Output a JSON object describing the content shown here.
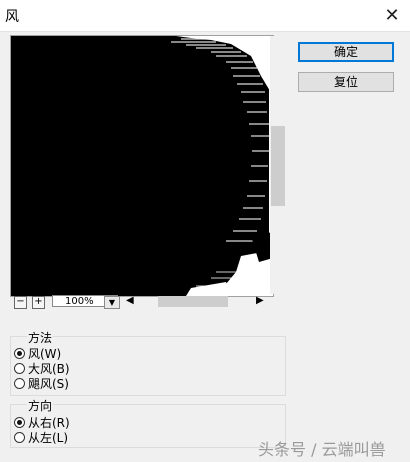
{
  "window": {
    "title": "风"
  },
  "buttons": {
    "ok": "确定",
    "reset": "复位"
  },
  "zoom": {
    "value": "100%",
    "minus": "−",
    "plus": "+"
  },
  "method": {
    "label": "方法",
    "options": [
      {
        "label": "风(W)",
        "selected": true
      },
      {
        "label": "大风(B)",
        "selected": false
      },
      {
        "label": "飓风(S)",
        "selected": false
      }
    ]
  },
  "direction": {
    "label": "方向",
    "options": [
      {
        "label": "从右(R)",
        "selected": true
      },
      {
        "label": "从左(L)",
        "selected": false
      }
    ]
  },
  "watermark": "头条号 / 云端叫兽"
}
